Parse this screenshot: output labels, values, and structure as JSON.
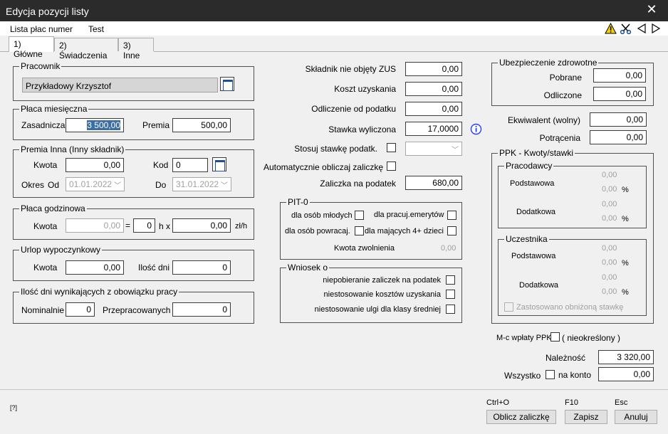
{
  "window": {
    "title": "Edycja pozycji listy",
    "close": "✕"
  },
  "menu": {
    "lista_plac_numer": "Lista płac numer",
    "test": "Test"
  },
  "toolbar_icons": [
    "warning-icon",
    "scissors-icon",
    "prev-triangle-icon",
    "next-triangle-icon"
  ],
  "tabs": [
    "1) Główne",
    "2) Świadczenia",
    "3) Inne"
  ],
  "pracownik": {
    "legend": "Pracownik",
    "value": "Przykładowy Krzysztof"
  },
  "placa_miesieczna": {
    "legend": "Płaca miesięczna",
    "zasadnicza_label": "Zasadnicza",
    "zasadnicza_value": "3 500,00",
    "premia_label": "Premia",
    "premia_value": "500,00"
  },
  "premia_inna": {
    "legend": "Premia Inna (Inny składnik)",
    "kwota_label": "Kwota",
    "kwota_value": "0,00",
    "kod_label": "Kod",
    "kod_value": "0",
    "okres_label": "Okres",
    "od_label": "Od",
    "od_value": "01.01.2022",
    "do_label": "Do",
    "do_value": "31.01.2022"
  },
  "placa_godzinowa": {
    "legend": "Płaca godzinowa",
    "kwota_label": "Kwota",
    "kwota_value": "0,00",
    "eq": "=",
    "hours_value": "0",
    "hx": "h x",
    "rate_value": "0,00",
    "unit": "zł/h"
  },
  "urlop": {
    "legend": "Urlop wypoczynkowy",
    "kwota_label": "Kwota",
    "kwota_value": "0,00",
    "ilosc_label": "Ilość dni",
    "ilosc_value": "0"
  },
  "ilosc_dni": {
    "legend": "Ilość dni wynikających z obowiązku pracy",
    "nominalnie_label": "Nominalnie",
    "nominalnie_value": "0",
    "przepracowanych_label": "Przepracowanych",
    "przepracowanych_value": "0"
  },
  "middle": {
    "skladnik_label": "Składnik nie objęty ZUS",
    "skladnik_value": "0,00",
    "koszt_label": "Koszt uzyskania",
    "koszt_value": "0,00",
    "odliczenie_label": "Odliczenie od podatku",
    "odliczenie_value": "0,00",
    "stawka_label": "Stawka wyliczona",
    "stawka_value": "17,0000",
    "stosuj_label": "Stosuj stawkę podatk.",
    "auto_label": "Automatycznie obliczaj zaliczkę",
    "zaliczka_label": "Zaliczka na podatek",
    "zaliczka_value": "680,00"
  },
  "pit0": {
    "legend": "PIT-0",
    "mlodych": "dla osób młodych",
    "emerytow": "dla pracuj.emerytów",
    "powracaj": "dla osób powracaj.",
    "dzieci": "dla mających 4+ dzieci",
    "kwota_label": "Kwota zwolnienia",
    "kwota_value": "0,00"
  },
  "wniosek": {
    "legend": "Wniosek o",
    "item1": "niepobieranie zaliczek na podatek",
    "item2": "niestosowanie  kosztów uzyskania",
    "item3": "niestosowanie ulgi dla klasy średniej"
  },
  "ubezpieczenie": {
    "legend": "Ubezpieczenie zdrowotne",
    "pobrane_label": "Pobrane",
    "pobrane_value": "0,00",
    "odliczone_label": "Odliczone",
    "odliczone_value": "0,00"
  },
  "ekwiwalent": {
    "label": "Ekwiwalent (wolny)",
    "value": "0,00"
  },
  "potracenia": {
    "label": "Potrącenia",
    "value": "0,00"
  },
  "ppk": {
    "legend": "PPK - Kwoty/stawki",
    "pracodawcy_legend": "Pracodawcy",
    "uczestnika_legend": "Uczestnika",
    "podstawowa": "Podstawowa",
    "dodatkowa": "Dodatkowa",
    "zero": "0,00",
    "pct": "%",
    "zastosowano": "Zastosowano obniżoną stawkę"
  },
  "mc_wplaty": {
    "label": "M-c wpłaty  PPK",
    "note": "( nieokreślony )"
  },
  "naleznosc": {
    "label": "Należność",
    "value": "3 320,00"
  },
  "wszystko": {
    "label": "Wszystko",
    "na_konto": "na konto",
    "value": "0,00"
  },
  "footer": {
    "help": "[?]",
    "oblicz_key": "Ctrl+O",
    "oblicz": "Oblicz zaliczkę",
    "zapisz_key": "F10",
    "zapisz": "Zapisz",
    "anuluj_key": "Esc",
    "anuluj": "Anuluj"
  },
  "colors": {
    "titlebar": "#2b2b2b",
    "selection": "#3a6ea5",
    "info_icon": "#1e40ff",
    "warning": "#f7d000"
  }
}
